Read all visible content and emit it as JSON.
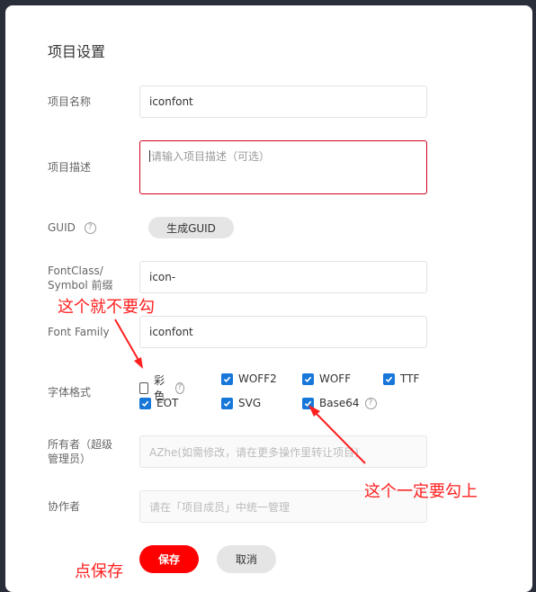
{
  "dialog": {
    "title": "项目设置",
    "name_label": "项目名称",
    "name_value": "iconfont",
    "desc_label": "项目描述",
    "desc_placeholder": "请输入项目描述（可选）",
    "guid_label": "GUID",
    "guid_button": "生成GUID",
    "fontclass_label_1": "FontClass/",
    "fontclass_label_2": "Symbol 前缀",
    "fontclass_value": "icon-",
    "fontfamily_label": "Font Family",
    "fontfamily_value": "iconfont",
    "format_label": "字体格式",
    "formats": [
      {
        "label": "彩色",
        "checked": false,
        "help": true
      },
      {
        "label": "WOFF2",
        "checked": true
      },
      {
        "label": "WOFF",
        "checked": true
      },
      {
        "label": "TTF",
        "checked": true
      },
      {
        "label": "EOT",
        "checked": true
      },
      {
        "label": "SVG",
        "checked": true
      },
      {
        "label": "Base64",
        "checked": true,
        "help": true
      }
    ],
    "owner_label_1": "所有者（超级",
    "owner_label_2": "管理员）",
    "owner_value": "AZhe(如需修改，请在更多操作里转让项目)",
    "collab_label": "协作者",
    "collab_placeholder": "请在「项目成员」中统一管理",
    "save_button": "保存",
    "cancel_button": "取消",
    "help_glyph": "?"
  },
  "annotations": {
    "no_check": "这个就不要勾",
    "must_check": "这个一定要勾上",
    "click_save": "点保存",
    "color": "#ff1f1f"
  }
}
